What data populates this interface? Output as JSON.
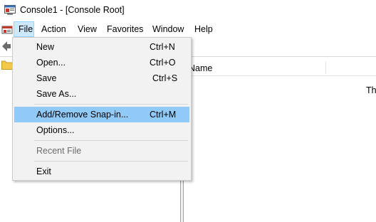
{
  "window": {
    "title": "Console1 - [Console Root]"
  },
  "menubar": {
    "items": [
      {
        "label": "File",
        "active": true
      },
      {
        "label": "Action"
      },
      {
        "label": "View"
      },
      {
        "label": "Favorites"
      },
      {
        "label": "Window"
      },
      {
        "label": "Help"
      }
    ]
  },
  "list": {
    "column_name": "Name",
    "partial_text": "Th"
  },
  "file_menu": {
    "items": [
      {
        "label": "New",
        "shortcut": "Ctrl+N"
      },
      {
        "label": "Open...",
        "shortcut": "Ctrl+O"
      },
      {
        "label": "Save",
        "shortcut": "Ctrl+S"
      },
      {
        "label": "Save As...",
        "shortcut": ""
      },
      {
        "label": "Add/Remove Snap-in...",
        "shortcut": "Ctrl+M",
        "highlighted": true
      },
      {
        "label": "Options...",
        "shortcut": ""
      },
      {
        "label": "Recent File",
        "shortcut": "",
        "disabled": true
      },
      {
        "label": "Exit",
        "shortcut": ""
      }
    ]
  },
  "colors": {
    "menu_highlight": "#91c9f7",
    "menubar_active": "#cce8ff",
    "disabled_text": "#6d6d6d"
  },
  "icons": [
    "mmc-app-icon",
    "mmc-console-icon",
    "back-arrow-icon",
    "folder-icon"
  ]
}
